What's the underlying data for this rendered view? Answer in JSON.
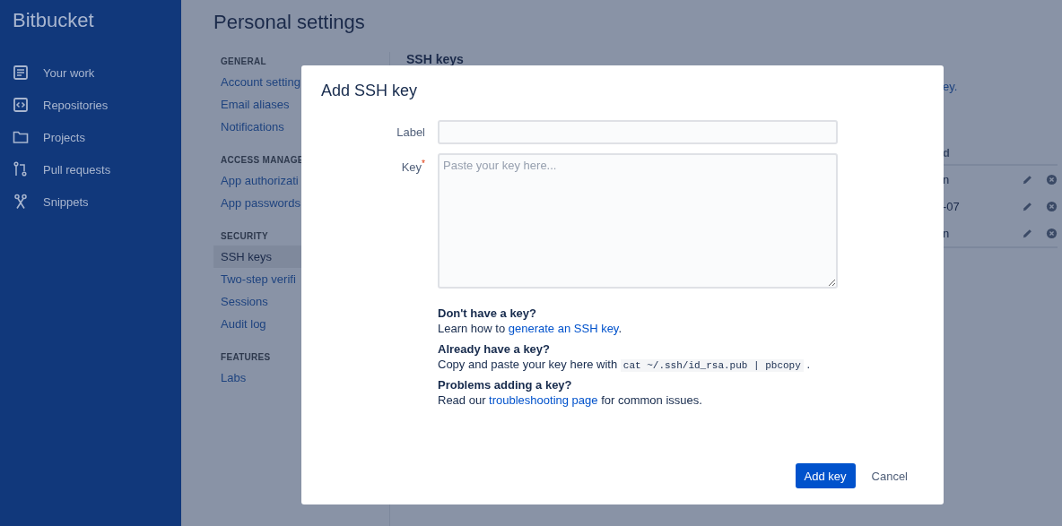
{
  "sidebar": {
    "logo": "Bitbucket",
    "items": [
      {
        "label": "Your work"
      },
      {
        "label": "Repositories"
      },
      {
        "label": "Projects"
      },
      {
        "label": "Pull requests"
      },
      {
        "label": "Snippets"
      }
    ]
  },
  "page": {
    "title": "Personal settings"
  },
  "nav": [
    {
      "heading": "GENERAL",
      "items": [
        {
          "label": "Account setting",
          "selected": false
        },
        {
          "label": "Email aliases",
          "selected": false
        },
        {
          "label": "Notifications",
          "selected": false
        }
      ]
    },
    {
      "heading": "ACCESS MANAGE",
      "items": [
        {
          "label": "App authorizati",
          "selected": false
        },
        {
          "label": "App passwords",
          "selected": false
        }
      ]
    },
    {
      "heading": "SECURITY",
      "items": [
        {
          "label": "SSH keys",
          "selected": true
        },
        {
          "label": "Two-step verifi",
          "selected": false
        },
        {
          "label": "Sessions",
          "selected": false
        },
        {
          "label": "Audit log",
          "selected": false
        }
      ]
    },
    {
      "heading": "FEATURES",
      "items": [
        {
          "label": "Labs",
          "selected": false
        }
      ]
    }
  ],
  "content": {
    "section_title": "SSH keys",
    "intro_fragment": "ey.",
    "table": {
      "header_fragment": "d",
      "rows": [
        {
          "cell": "n"
        },
        {
          "cell": "-07"
        },
        {
          "cell": "n"
        }
      ]
    }
  },
  "dialog": {
    "title": "Add SSH key",
    "fields": [
      {
        "kind": "input",
        "label": "Label"
      },
      {
        "kind": "textarea",
        "label": "Key",
        "required_marker": "*",
        "placeholder": "Paste your key here..."
      }
    ],
    "help": [
      {
        "heading": "Don't have a key?",
        "parts": [
          {
            "kind": "text",
            "text": "Learn how to "
          },
          {
            "kind": "link",
            "text": "generate an SSH key"
          },
          {
            "kind": "text",
            "text": "."
          }
        ]
      },
      {
        "heading": "Already have a key?",
        "parts": [
          {
            "kind": "text",
            "text": "Copy and paste your key here with "
          },
          {
            "kind": "code",
            "text": "cat ~/.ssh/id_rsa.pub | pbcopy"
          },
          {
            "kind": "text",
            "text": " ."
          }
        ]
      },
      {
        "heading": "Problems adding a key?",
        "parts": [
          {
            "kind": "text",
            "text": "Read our "
          },
          {
            "kind": "link",
            "text": "troubleshooting page"
          },
          {
            "kind": "text",
            "text": " for common issues."
          }
        ]
      }
    ],
    "buttons": [
      {
        "kind": "primary",
        "label": "Add key"
      },
      {
        "kind": "subtle",
        "label": "Cancel"
      }
    ]
  }
}
